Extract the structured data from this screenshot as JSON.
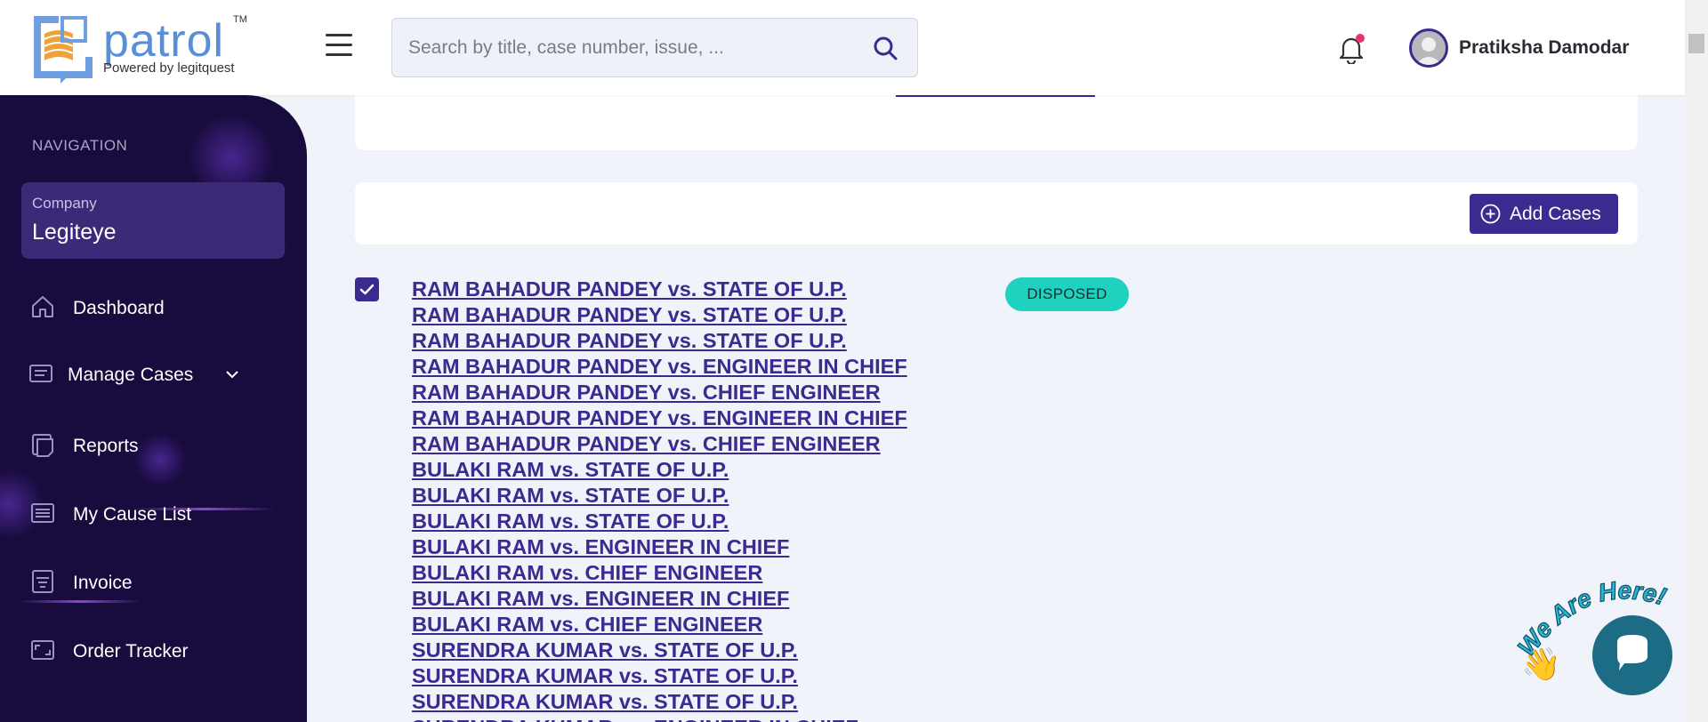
{
  "header": {
    "logo_word": "patrol",
    "logo_tm": "TM",
    "logo_sub": "Powered by legitquest",
    "search_placeholder": "Search by title, case number, issue, ...",
    "user_name": "Pratiksha Damodar",
    "notification_dot_color": "#e8336d"
  },
  "sidebar": {
    "heading": "NAVIGATION",
    "company_label": "Company",
    "company_value": "Legiteye",
    "items": [
      {
        "label": "Dashboard",
        "icon": "home-icon"
      },
      {
        "label": "Manage Cases",
        "icon": "cases-icon"
      },
      {
        "label": "Reports",
        "icon": "reports-icon"
      },
      {
        "label": "My Cause List",
        "icon": "cause-list-icon"
      },
      {
        "label": "Invoice",
        "icon": "invoice-icon"
      },
      {
        "label": "Order Tracker",
        "icon": "order-tracker-icon"
      }
    ]
  },
  "main": {
    "add_cases_label": "Add Cases",
    "status": "DISPOSED",
    "cases": [
      "RAM BAHADUR PANDEY vs. STATE OF U.P.",
      "RAM BAHADUR PANDEY vs. STATE OF U.P.",
      "RAM BAHADUR PANDEY vs. STATE OF U.P.",
      "RAM BAHADUR PANDEY vs. ENGINEER IN CHIEF",
      "RAM BAHADUR PANDEY vs. CHIEF ENGINEER",
      "RAM BAHADUR PANDEY vs. ENGINEER IN CHIEF",
      "RAM BAHADUR PANDEY vs. CHIEF ENGINEER",
      "BULAKI RAM vs. STATE OF U.P.",
      "BULAKI RAM vs. STATE OF U.P.",
      "BULAKI RAM vs. STATE OF U.P.",
      "BULAKI RAM vs. ENGINEER IN CHIEF",
      "BULAKI RAM vs. CHIEF ENGINEER",
      "BULAKI RAM vs. ENGINEER IN CHIEF",
      "BULAKI RAM vs. CHIEF ENGINEER",
      "SURENDRA KUMAR vs. STATE OF U.P.",
      "SURENDRA KUMAR vs. STATE OF U.P.",
      "SURENDRA KUMAR vs. STATE OF U.P.",
      "SURENDRA KUMAR vs. ENGINEER IN CHIEF"
    ]
  },
  "chat": {
    "tagline": "We Are Here!",
    "wave_emoji": "👋"
  },
  "colors": {
    "brand_purple": "#3b2a8f",
    "sidebar_bg": "#180b3d",
    "status_teal": "#1fd2bf",
    "chat_teal": "#1b6c84",
    "tagline_fill": "#2bb5d6"
  }
}
